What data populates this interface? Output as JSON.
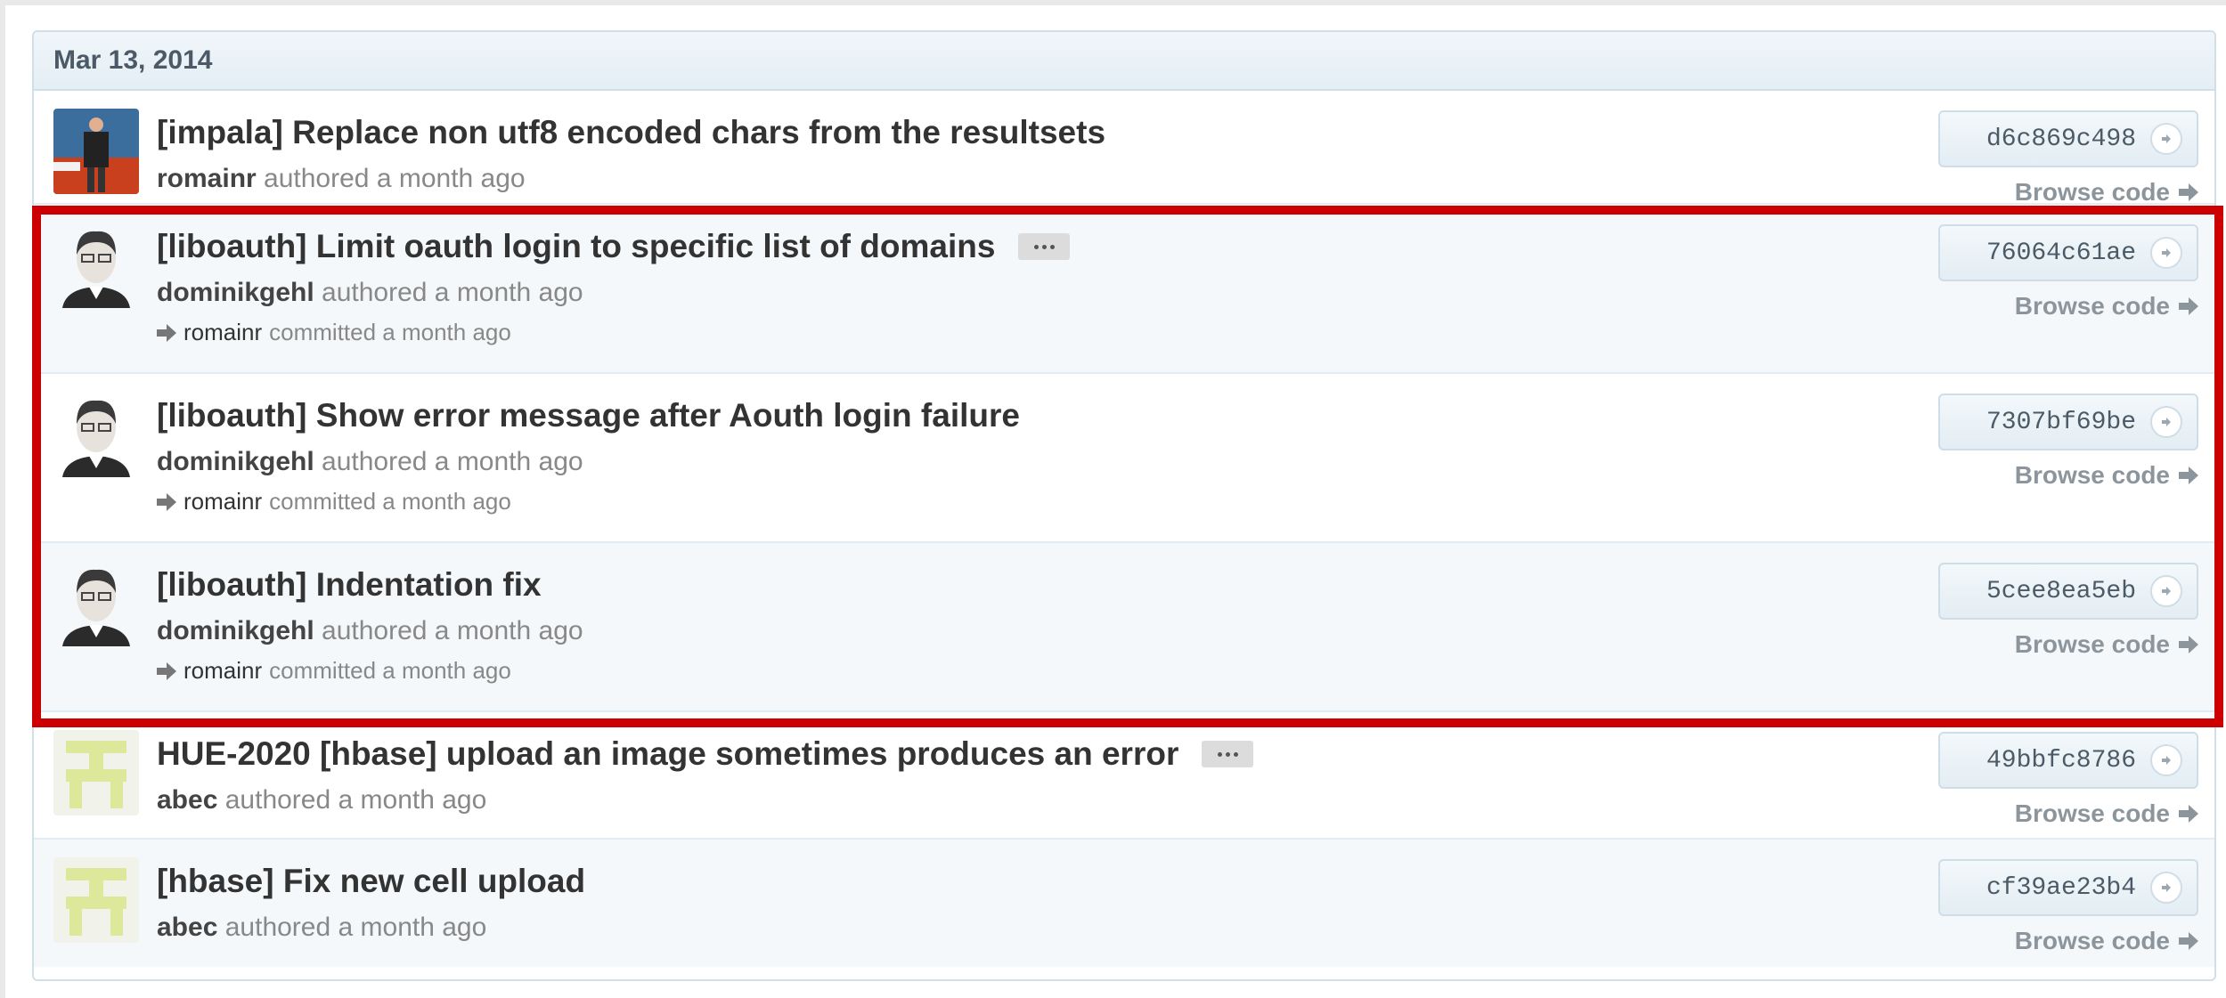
{
  "date_header": "Mar 13, 2014",
  "browse_label": "Browse code",
  "commits": [
    {
      "message": "[impala] Replace non utf8 encoded chars from the resultsets",
      "author": "romainr",
      "authored_text": "authored a month ago",
      "sha": "d6c869c498",
      "avatar": "photo-avatar-icon"
    },
    {
      "message": "[liboauth] Limit oauth login to specific list of domains",
      "author": "dominikgehl",
      "authored_text": "authored a month ago",
      "committer": "romainr",
      "committed_text": "committed a month ago",
      "sha": "76064c61ae",
      "avatar": "portrait-avatar-icon"
    },
    {
      "message": "[liboauth] Show error message after Aouth login failure",
      "author": "dominikgehl",
      "authored_text": "authored a month ago",
      "committer": "romainr",
      "committed_text": "committed a month ago",
      "sha": "7307bf69be",
      "avatar": "portrait-avatar-icon"
    },
    {
      "message": "[liboauth] Indentation fix",
      "author": "dominikgehl",
      "authored_text": "authored a month ago",
      "committer": "romainr",
      "committed_text": "committed a month ago",
      "sha": "5cee8ea5eb",
      "avatar": "portrait-avatar-icon"
    },
    {
      "message": "HUE-2020 [hbase] upload an image sometimes produces an error",
      "author": "abec",
      "authored_text": "authored a month ago",
      "sha": "49bbfc8786",
      "avatar": "identicon-avatar-icon"
    },
    {
      "message": "[hbase] Fix new cell upload",
      "author": "abec",
      "authored_text": "authored a month ago",
      "sha": "cf39ae23b4",
      "avatar": "identicon-avatar-icon"
    }
  ],
  "colors": {
    "highlight": "#cc0000",
    "identicon": "#dde89a",
    "header_bg": "#e4eef5"
  }
}
